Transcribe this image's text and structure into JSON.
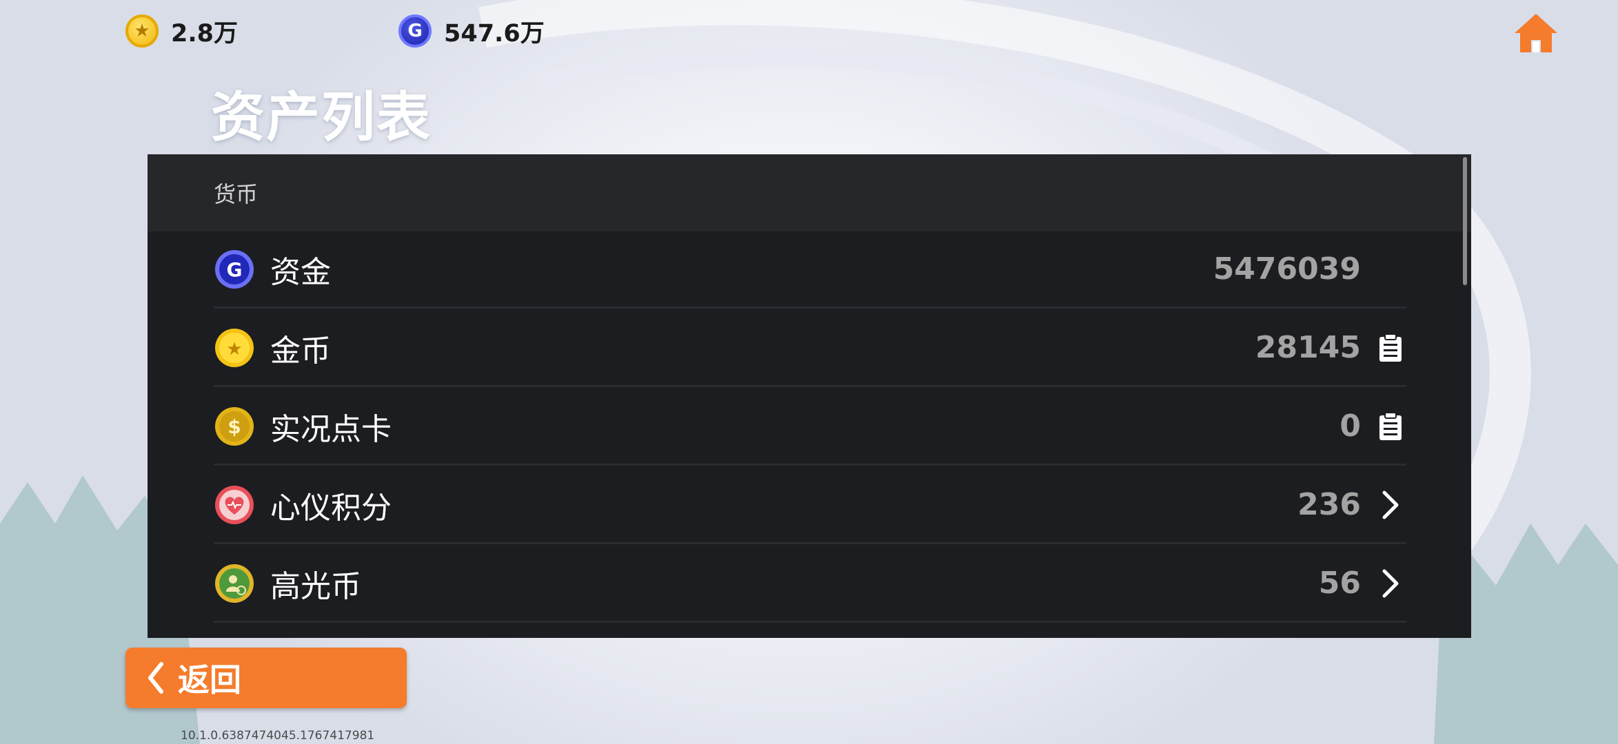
{
  "resources": {
    "coin_value": "2.8万",
    "cash_value": "547.6万"
  },
  "title": "资产列表",
  "section": {
    "label": "货币"
  },
  "rows": [
    {
      "label": "资金",
      "amount": "5476039",
      "icon": "cash-g-icon",
      "action": "none"
    },
    {
      "label": "金币",
      "amount": "28145",
      "icon": "gold-star-coin-icon",
      "action": "clipboard-icon"
    },
    {
      "label": "实况点卡",
      "amount": "0",
      "icon": "dollar-coin-icon",
      "action": "clipboard-icon"
    },
    {
      "label": "心仪积分",
      "amount": "236",
      "icon": "heart-points-icon",
      "action": "chevron-right-icon"
    },
    {
      "label": "高光币",
      "amount": "56",
      "icon": "highlight-coin-icon",
      "action": "chevron-right-icon"
    }
  ],
  "back": {
    "label": "返回"
  },
  "version": "10.1.0.6387474045.1767417981",
  "colors": {
    "accent": "#f47c2c",
    "panel": "#1c1d20",
    "section_header": "#26272a",
    "home": "#f47c2c"
  }
}
